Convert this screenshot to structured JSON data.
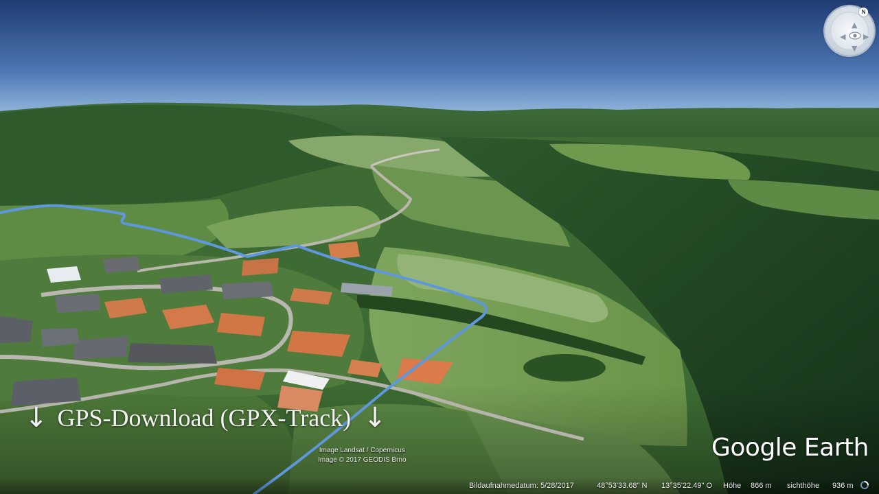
{
  "caption": {
    "arrow_left": "↓",
    "text": "GPS-Download (GPX-Track)",
    "arrow_right": "↓"
  },
  "imagery_credit": {
    "line1": "Image Landsat / Copernicus",
    "line2": "Image © 2017 GEODIS Brno"
  },
  "logo": {
    "text": "Google Earth"
  },
  "nav": {
    "north_label": "N",
    "icon": "navigation-compass-icon"
  },
  "status": {
    "imagery_date": "Bildaufnahmedatum: 5/28/2017",
    "latitude": "48°53'33.68\" N",
    "longitude": "13°35'22.49\" O",
    "elevation_label": "Höhe",
    "elevation_value": "866 m",
    "eye_alt_label": "sichthöhe",
    "eye_alt_value": "936 m"
  },
  "colors": {
    "sky_top": "#203c73",
    "sky_horizon": "#8eb4dc",
    "forest": "#244a26",
    "meadow": "#6f9a4e",
    "roof": "#d47a4a",
    "gps_track": "#5f97dc"
  }
}
